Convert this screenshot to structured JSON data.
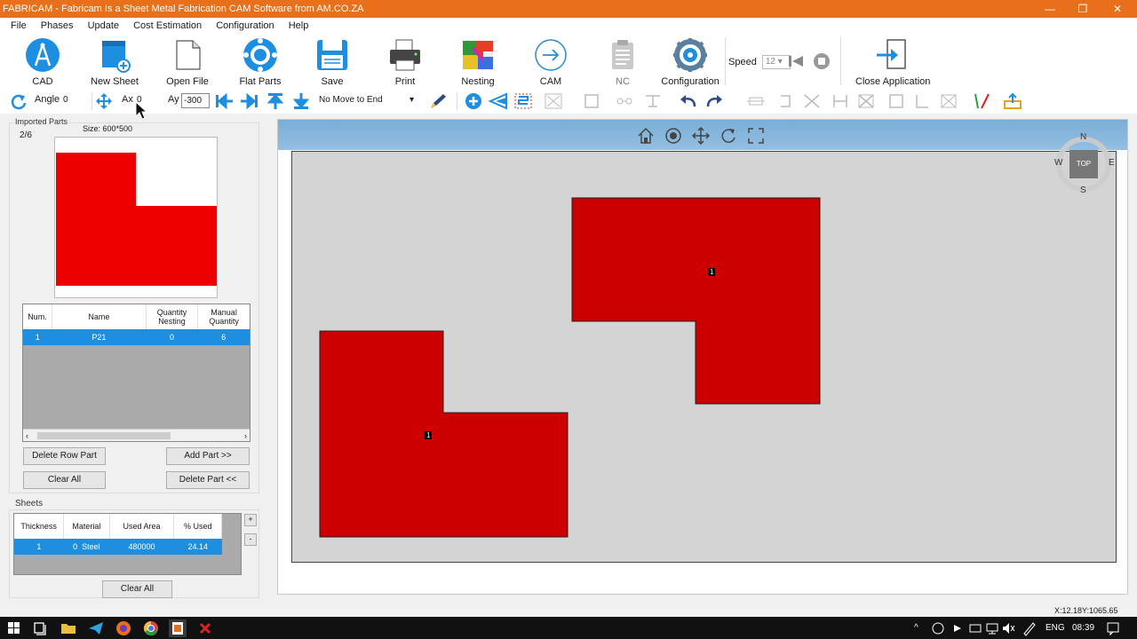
{
  "window": {
    "title": "FABRICAM - Fabricam Is a Sheet Metal Fabrication CAM Software from AM.CO.ZA",
    "minimize": "—",
    "maximize": "❐",
    "close": "✕"
  },
  "menu": [
    "File",
    "Phases",
    "Update",
    "Cost Estimation",
    "Configuration",
    "Help"
  ],
  "ribbon": {
    "cad": "CAD",
    "new_sheet": "New Sheet",
    "open_file": "Open File",
    "flat_parts": "Flat Parts",
    "save": "Save",
    "print": "Print",
    "nesting": "Nesting",
    "cam": "CAM",
    "nc": "NC",
    "configuration": "Configuration",
    "speed_label": "Speed",
    "speed_value": "12",
    "close_application": "Close Application"
  },
  "toolbar": {
    "angle_label": "Angle",
    "angle_value": "0",
    "ax_label": "Ax",
    "ax_value": "0",
    "ay_label": "Ay",
    "ay_value": "-300",
    "move_mode": "No Move to End"
  },
  "imported_parts": {
    "title": "Imported Parts",
    "counter": "2/6",
    "size": "Size: 600*500",
    "columns": [
      "Num.",
      "Name",
      "Quantity Nesting",
      "Manual Quantity"
    ],
    "rows": [
      {
        "num": "1",
        "name": "P21",
        "qty_nesting": "0",
        "manual_qty": "6"
      }
    ],
    "delete_row": "Delete Row Part",
    "add_part": "Add Part >>",
    "clear_all": "Clear All",
    "delete_part": "Delete Part <<"
  },
  "sheets": {
    "title": "Sheets",
    "columns": [
      "Thickness",
      "Material",
      "Used Area",
      "% Used"
    ],
    "rows": [
      {
        "thickness": "1",
        "material_id": "0",
        "material": "Steel",
        "used_area": "480000",
        "used_pct": "24.14"
      }
    ],
    "plus": "+",
    "minus": "-",
    "clear_all": "Clear All"
  },
  "viewcube": {
    "n": "N",
    "s": "S",
    "w": "W",
    "e": "E",
    "top": "TOP"
  },
  "parts_on_sheet": [
    {
      "label": "1"
    },
    {
      "label": "1"
    }
  ],
  "status": {
    "coords": "X:12.18Y:1065.65"
  },
  "taskbar": {
    "lang": "ENG",
    "time": "08:39"
  },
  "colors": {
    "accent": "#e8701a",
    "part_red": "#cc0000",
    "selection": "#1e8fe0"
  }
}
